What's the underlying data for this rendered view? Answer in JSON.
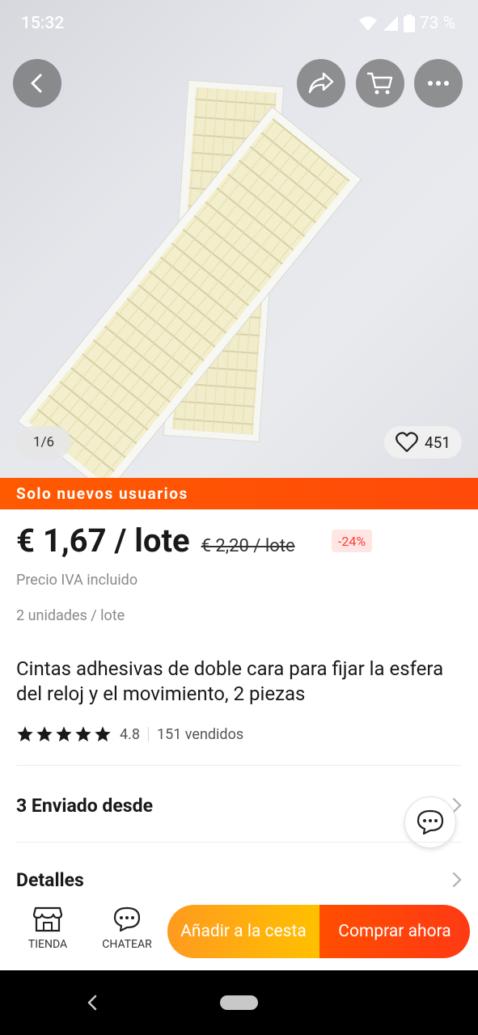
{
  "status_bar": {
    "time": "15:32",
    "battery": "73 %"
  },
  "gallery": {
    "counter": "1/6",
    "wishlist_count": "451"
  },
  "promo_banner": "Solo nuevos usuarios",
  "pricing": {
    "price": "€ 1,67 / lote",
    "old_price": "€ 2,20 / lote",
    "discount": "-24%",
    "vat_note": "Precio IVA incluido",
    "units": "2 unidades / lote"
  },
  "product": {
    "title": "Cintas adhesivas de doble cara para fijar la esfera del reloj y el movimiento, 2 piezas",
    "rating": "4.8",
    "sold": "151 vendidos",
    "stars": 5
  },
  "sections": {
    "shipping": "3 Enviado desde",
    "details": "Detalles"
  },
  "bottom_bar": {
    "store_label": "TIENDA",
    "chat_label": "CHATEAR",
    "add_to_cart": "Añadir a la cesta",
    "buy_now": "Comprar ahora"
  },
  "colors": {
    "promo": "#ff5a00",
    "discount_text": "#ff3b30",
    "add_to_cart": "#ffb000",
    "buy_now": "#ff4300"
  }
}
